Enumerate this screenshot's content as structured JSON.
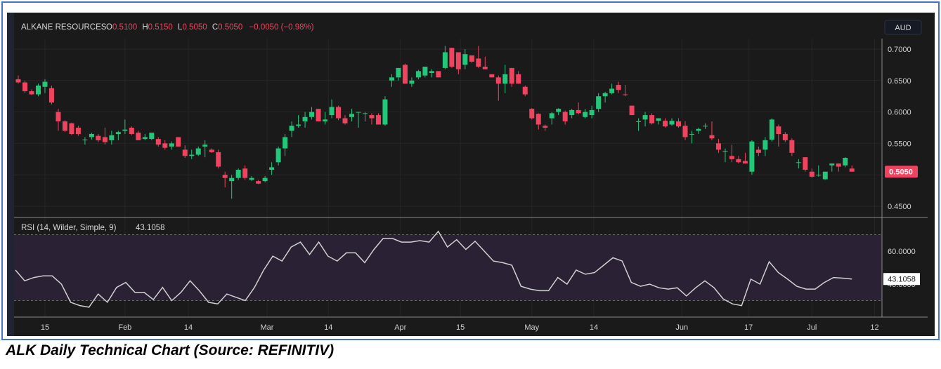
{
  "header": {
    "symbol": "ALKANE RESOURCES",
    "o_label": "O",
    "o_value": "0.5100",
    "h_label": "H",
    "h_value": "0.5150",
    "l_label": "L",
    "l_value": "0.5050",
    "c_label": "C",
    "c_value": "0.5050",
    "change": "−0.0050 (−0.98%)",
    "currency": "AUD"
  },
  "rsi_label": "RSI (14, Wilder, Simple, 9)",
  "rsi_value": "43.1058",
  "last_price_label": "0.5050",
  "caption": "ALK Daily Technical Chart (Source: REFINITIV)",
  "colors": {
    "up": "#22c77a",
    "down": "#f0435f",
    "background": "#1a1a1a",
    "rsi_line": "#d0d0d0",
    "rsi_band": "#2a2234"
  },
  "chart_data": [
    {
      "type": "candlestick",
      "title": "ALKANE RESOURCES",
      "ylabel": "AUD",
      "ylim": [
        0.43,
        0.72
      ],
      "y_ticks": [
        "0.7000",
        "0.6500",
        "0.6000",
        "0.5500",
        "0.4500"
      ],
      "x_ticks": [
        {
          "label": "15",
          "index": 4
        },
        {
          "label": "Feb",
          "index": 16
        },
        {
          "label": "14",
          "index": 25.5
        },
        {
          "label": "Mar",
          "index": 37.3
        },
        {
          "label": "14",
          "index": 46.5
        },
        {
          "label": "Apr",
          "index": 57.3
        },
        {
          "label": "15",
          "index": 66.3
        },
        {
          "label": "May",
          "index": 77
        },
        {
          "label": "14",
          "index": 86.3
        },
        {
          "label": "Jun",
          "index": 99.5
        },
        {
          "label": "17",
          "index": 109.5
        },
        {
          "label": "Jul",
          "index": 119
        },
        {
          "label": "12",
          "index": 128.4
        }
      ],
      "ohlc": [
        [
          0.652,
          0.658,
          0.645,
          0.647
        ],
        [
          0.647,
          0.65,
          0.63,
          0.633
        ],
        [
          0.633,
          0.636,
          0.627,
          0.628
        ],
        [
          0.628,
          0.645,
          0.625,
          0.642
        ],
        [
          0.64,
          0.652,
          0.63,
          0.648
        ],
        [
          0.638,
          0.642,
          0.612,
          0.615
        ],
        [
          0.6,
          0.605,
          0.57,
          0.585
        ],
        [
          0.585,
          0.587,
          0.568,
          0.57
        ],
        [
          0.582,
          0.583,
          0.563,
          0.565
        ],
        [
          0.575,
          0.578,
          0.562,
          0.565
        ],
        [
          0.556,
          0.56,
          0.548,
          0.556
        ],
        [
          0.56,
          0.567,
          0.556,
          0.565
        ],
        [
          0.562,
          0.565,
          0.552,
          0.555
        ],
        [
          0.56,
          0.575,
          0.548,
          0.552
        ],
        [
          0.555,
          0.57,
          0.548,
          0.563
        ],
        [
          0.565,
          0.57,
          0.555,
          0.568
        ],
        [
          0.57,
          0.588,
          0.565,
          0.572
        ],
        [
          0.575,
          0.577,
          0.563,
          0.565
        ],
        [
          0.567,
          0.57,
          0.555,
          0.555
        ],
        [
          0.557,
          0.565,
          0.555,
          0.56
        ],
        [
          0.557,
          0.567,
          0.555,
          0.567
        ],
        [
          0.557,
          0.56,
          0.545,
          0.548
        ],
        [
          0.55,
          0.555,
          0.54,
          0.543
        ],
        [
          0.545,
          0.553,
          0.54,
          0.55
        ],
        [
          0.56,
          0.56,
          0.545,
          0.545
        ],
        [
          0.54,
          0.547,
          0.527,
          0.53
        ],
        [
          0.53,
          0.54,
          0.525,
          0.532
        ],
        [
          0.532,
          0.545,
          0.53,
          0.542
        ],
        [
          0.545,
          0.555,
          0.528,
          0.548
        ],
        [
          0.54,
          0.542,
          0.535,
          0.536
        ],
        [
          0.536,
          0.54,
          0.51,
          0.513
        ],
        [
          0.5,
          0.505,
          0.48,
          0.495
        ],
        [
          0.49,
          0.5,
          0.462,
          0.495
        ],
        [
          0.495,
          0.51,
          0.492,
          0.508
        ],
        [
          0.51,
          0.515,
          0.492,
          0.495
        ],
        [
          0.492,
          0.498,
          0.49,
          0.495
        ],
        [
          0.49,
          0.492,
          0.485,
          0.486
        ],
        [
          0.49,
          0.498,
          0.488,
          0.495
        ],
        [
          0.508,
          0.52,
          0.5,
          0.512
        ],
        [
          0.52,
          0.545,
          0.515,
          0.542
        ],
        [
          0.542,
          0.565,
          0.53,
          0.56
        ],
        [
          0.57,
          0.585,
          0.56,
          0.578
        ],
        [
          0.578,
          0.595,
          0.575,
          0.58
        ],
        [
          0.585,
          0.6,
          0.575,
          0.592
        ],
        [
          0.592,
          0.608,
          0.588,
          0.6
        ],
        [
          0.605,
          0.605,
          0.585,
          0.585
        ],
        [
          0.585,
          0.6,
          0.58,
          0.588
        ],
        [
          0.595,
          0.62,
          0.59,
          0.608
        ],
        [
          0.608,
          0.61,
          0.587,
          0.59
        ],
        [
          0.59,
          0.595,
          0.58,
          0.582
        ],
        [
          0.592,
          0.605,
          0.585,
          0.597
        ],
        [
          0.6,
          0.6,
          0.575,
          0.6
        ],
        [
          0.598,
          0.6,
          0.585,
          0.598
        ],
        [
          0.595,
          0.598,
          0.58,
          0.59
        ],
        [
          0.595,
          0.598,
          0.58,
          0.58
        ],
        [
          0.58,
          0.625,
          0.578,
          0.62
        ],
        [
          0.65,
          0.66,
          0.64,
          0.655
        ],
        [
          0.655,
          0.67,
          0.65,
          0.67
        ],
        [
          0.675,
          0.677,
          0.645,
          0.645
        ],
        [
          0.645,
          0.655,
          0.64,
          0.65
        ],
        [
          0.655,
          0.667,
          0.652,
          0.665
        ],
        [
          0.658,
          0.672,
          0.655,
          0.672
        ],
        [
          0.662,
          0.668,
          0.655,
          0.665
        ],
        [
          0.665,
          0.665,
          0.655,
          0.655
        ],
        [
          0.67,
          0.705,
          0.668,
          0.695
        ],
        [
          0.702,
          0.702,
          0.67,
          0.672
        ],
        [
          0.695,
          0.695,
          0.66,
          0.668
        ],
        [
          0.675,
          0.7,
          0.668,
          0.692
        ],
        [
          0.69,
          0.69,
          0.678,
          0.68
        ],
        [
          0.685,
          0.705,
          0.67,
          0.672
        ],
        [
          0.672,
          0.688,
          0.668,
          0.668
        ],
        [
          0.66,
          0.66,
          0.655,
          0.655
        ],
        [
          0.655,
          0.658,
          0.618,
          0.645
        ],
        [
          0.645,
          0.675,
          0.63,
          0.66
        ],
        [
          0.67,
          0.67,
          0.64,
          0.645
        ],
        [
          0.66,
          0.665,
          0.645,
          0.645
        ],
        [
          0.64,
          0.642,
          0.625,
          0.628
        ],
        [
          0.605,
          0.606,
          0.588,
          0.59
        ],
        [
          0.597,
          0.598,
          0.572,
          0.58
        ],
        [
          0.578,
          0.58,
          0.57,
          0.575
        ],
        [
          0.59,
          0.6,
          0.58,
          0.598
        ],
        [
          0.6,
          0.606,
          0.595,
          0.605
        ],
        [
          0.6,
          0.602,
          0.58,
          0.585
        ],
        [
          0.595,
          0.605,
          0.59,
          0.603
        ],
        [
          0.603,
          0.615,
          0.596,
          0.598
        ],
        [
          0.592,
          0.605,
          0.59,
          0.6
        ],
        [
          0.595,
          0.61,
          0.59,
          0.603
        ],
        [
          0.605,
          0.63,
          0.6,
          0.625
        ],
        [
          0.625,
          0.632,
          0.615,
          0.63
        ],
        [
          0.63,
          0.645,
          0.628,
          0.637
        ],
        [
          0.643,
          0.648,
          0.63,
          0.635
        ],
        [
          0.628,
          0.643,
          0.625,
          0.627
        ],
        [
          0.61,
          0.61,
          0.595,
          0.595
        ],
        [
          0.585,
          0.59,
          0.57,
          0.585
        ],
        [
          0.588,
          0.6,
          0.577,
          0.595
        ],
        [
          0.595,
          0.598,
          0.58,
          0.582
        ],
        [
          0.586,
          0.59,
          0.58,
          0.59
        ],
        [
          0.586,
          0.59,
          0.575,
          0.577
        ],
        [
          0.58,
          0.59,
          0.578,
          0.586
        ],
        [
          0.585,
          0.59,
          0.575,
          0.577
        ],
        [
          0.578,
          0.585,
          0.555,
          0.56
        ],
        [
          0.565,
          0.57,
          0.55,
          0.565
        ],
        [
          0.57,
          0.575,
          0.565,
          0.573
        ],
        [
          0.578,
          0.582,
          0.573,
          0.578
        ],
        [
          0.563,
          0.585,
          0.555,
          0.558
        ],
        [
          0.55,
          0.557,
          0.535,
          0.54
        ],
        [
          0.538,
          0.542,
          0.52,
          0.538
        ],
        [
          0.53,
          0.548,
          0.52,
          0.525
        ],
        [
          0.525,
          0.53,
          0.518,
          0.52
        ],
        [
          0.522,
          0.535,
          0.518,
          0.518
        ],
        [
          0.505,
          0.555,
          0.5,
          0.553
        ],
        [
          0.54,
          0.545,
          0.53,
          0.535
        ],
        [
          0.54,
          0.56,
          0.53,
          0.555
        ],
        [
          0.556,
          0.59,
          0.553,
          0.588
        ],
        [
          0.577,
          0.58,
          0.545,
          0.565
        ],
        [
          0.565,
          0.568,
          0.552,
          0.555
        ],
        [
          0.555,
          0.558,
          0.53,
          0.535
        ],
        [
          0.52,
          0.525,
          0.51,
          0.52
        ],
        [
          0.528,
          0.528,
          0.505,
          0.508
        ],
        [
          0.505,
          0.51,
          0.495,
          0.497
        ],
        [
          0.5,
          0.515,
          0.497,
          0.5
        ],
        [
          0.493,
          0.505,
          0.492,
          0.505
        ],
        [
          0.515,
          0.518,
          0.505,
          0.518
        ],
        [
          0.518,
          0.518,
          0.505,
          0.513
        ],
        [
          0.515,
          0.528,
          0.512,
          0.527
        ],
        [
          0.51,
          0.515,
          0.505,
          0.505
        ]
      ],
      "last_price": 0.505
    },
    {
      "type": "line",
      "title": "RSI (14, Wilder, Simple, 9)",
      "ylim": [
        20,
        80
      ],
      "y_ticks": [
        "60.0000",
        "40.0000"
      ],
      "bands": [
        70,
        30
      ],
      "values": [
        48.5,
        42,
        44,
        45,
        45,
        40,
        29,
        27,
        26,
        34,
        29,
        38,
        41,
        35,
        35,
        30.6,
        38,
        30,
        35,
        42,
        36,
        29,
        28,
        34,
        32,
        30,
        38,
        48.5,
        57,
        54,
        62.5,
        65.5,
        58,
        65.5,
        57,
        54,
        59,
        59,
        53,
        61,
        67.7,
        67.7,
        65.5,
        65.5,
        66.4,
        65.5,
        72,
        62.5,
        67,
        61,
        66,
        60,
        54,
        53,
        51.5,
        38.7,
        37,
        36,
        36,
        44,
        40,
        48.5,
        46,
        47,
        51.5,
        56,
        54,
        41,
        38.7,
        40,
        37.8,
        37,
        37.8,
        32.8,
        37.8,
        42,
        37.8,
        31,
        28,
        27,
        43,
        40,
        53.6,
        47,
        43,
        38.7,
        37,
        37,
        41,
        44,
        43.6,
        43.1
      ]
    }
  ]
}
